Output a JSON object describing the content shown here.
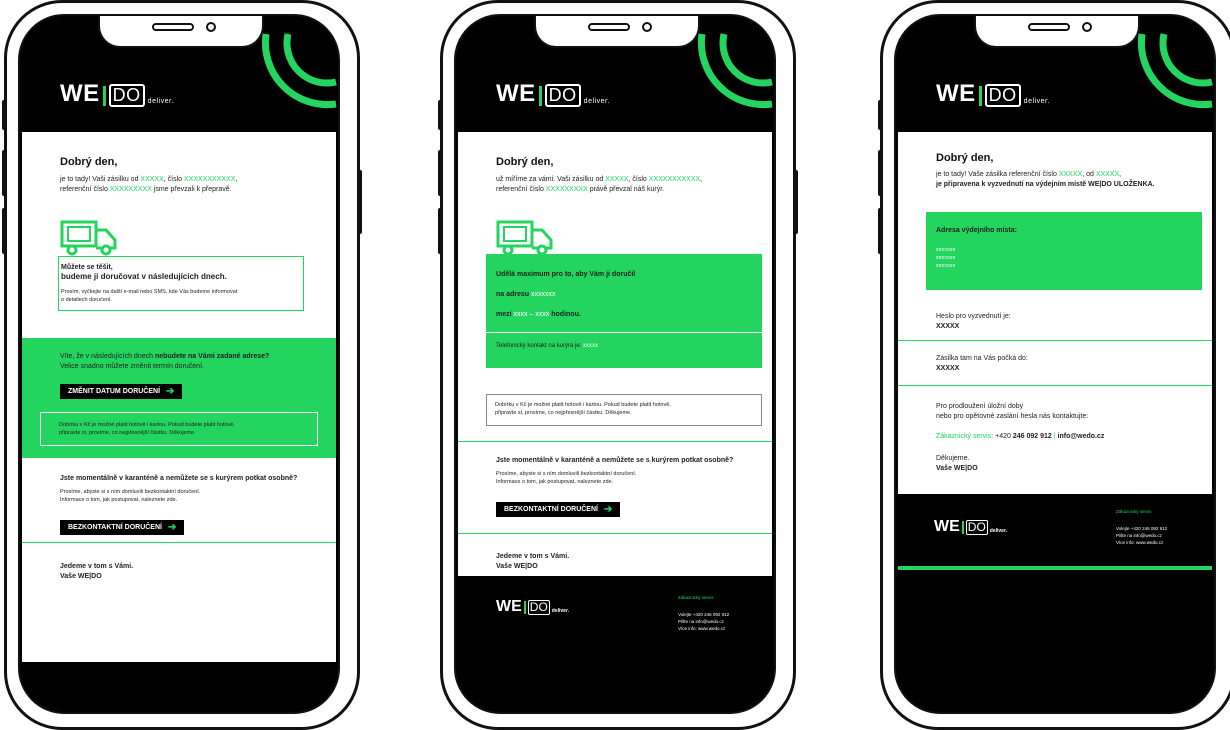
{
  "brand": {
    "we": "WE",
    "do": "DO",
    "deliver": "deliver.",
    "accent": "#23d45e"
  },
  "phone1": {
    "greeting": "Dobrý den,",
    "intro": {
      "p1": "je to tady! Vaši zásilku od ",
      "x1": "XXXXX",
      "p2": ", číslo ",
      "x2": "XXXXXXXXXXX",
      "p3": ",",
      "p4": "referenční číslo ",
      "x3": "XXXXXXXXX",
      "p5": " jsme převzali k přepravě."
    },
    "box1": {
      "g": "Můžete se těšit,",
      "b": "budeme ji doručovat v následujících dnech.",
      "s1": "Prosím, vyčkejte na další e-mail nebo SMS, kde Vás budeme informovat",
      "s2": "o detailech doručení."
    },
    "green": {
      "p1": "Víte, že v následujících dnech ",
      "b1": "nebudete na Vámi zadané adrese?",
      "p2": "Velice snadno můžete změnit termín doručení.",
      "btn": "ZMĚNIT DATUM DORUČENÍ",
      "cod1": "Dobírku v Kč je možné platit hotově i kartou. Pokud budete platit hotově,",
      "cod2": "připravte si, prosíme, co nejpřesnější částku. Děkujeme."
    },
    "quar": {
      "title": "Jste momentálně v karanténě a nemůžete se s kurýrem potkat osobně?",
      "s1": "Prosíme, abyste si s ním domluvili bezkontaktní doručení.",
      "s2": "Informace o tom, jak postupovat, naleznete zde.",
      "btn": "BEZKONTAKTNÍ DORUČENÍ"
    },
    "sign": {
      "l1": "Jedeme v tom s Vámi.",
      "l2": "Vaše WE|DO"
    }
  },
  "phone2": {
    "greeting": "Dobrý den,",
    "intro": {
      "p1": "už míříme za vámi. Vaši zásilku od ",
      "x1": "XXXXX",
      "p2": ", číslo ",
      "x2": "XXXXXXXXXXX",
      "p3": ",",
      "p4": "referenční číslo ",
      "x3": "XXXXXXXXX",
      "p5": " právě převzal náš kurýr."
    },
    "green": {
      "l1": "Udělá maximum pro to, aby Vám ji doručil",
      "l2a": "na adresu ",
      "l2b": "xxxxxxx",
      "l3a": "mezi ",
      "l3b": "xxxx – xxxx",
      "l3c": " hodinou.",
      "tel": "Telefonický kontakt na kurýra je: ",
      "telx": "xxxxx"
    },
    "cod": {
      "s1": "Dobírku v Kč je možné platit hotově i kartou. Pokud budete platit hotově,",
      "s2": "připravte si, prosíme, co nejpřesnější částku. Děkujeme."
    },
    "quar": {
      "title": "Jste momentálně v karanténě a nemůžete se s kurýrem potkat osobně?",
      "s1": "Prosíme, abyste si s ním domluvili bezkontaktní doručení.",
      "s2": "Informace o tom, jak postupovat, naleznete zde.",
      "btn": "BEZKONTAKTNÍ DORUČENÍ"
    },
    "sign": {
      "l1": "Jedeme v tom s Vámi.",
      "l2": "Vaše WE|DO"
    },
    "footer": {
      "t": "Zákaznický servis",
      "l1": "Volejte +420 246 092 912",
      "l2": "Pište na info@wedo.cz",
      "l3": "Více info: www.wedo.cz"
    }
  },
  "phone3": {
    "greeting": "Dobrý den,",
    "intro": {
      "p1": "je to tady! Vaše zásilka referenční číslo ",
      "x1": "XXXXX",
      "p2": ", od ",
      "x2": "XXXXX",
      "p3": ",",
      "b": "je připravena k vyzvednutí na výdejním místě  WE|DO ULOŽENKA."
    },
    "green": {
      "title": "Adresa výdejního místa:",
      "a1": "xxxxxxx",
      "a2": "xxxxxxx",
      "a3": "xxxxxxx"
    },
    "pw": {
      "l": "Heslo pro vyzvednutí je:",
      "v": "XXXXX"
    },
    "wait": {
      "l": "Zásilka tam na Vás počká do:",
      "v": "XXXXX"
    },
    "ext": {
      "l1": "Pro prodloužení úložní doby",
      "l2": "nebo pro opětovné zaslání hesla nás kontaktujte:",
      "cs": "Zákaznický servis:",
      "ph1": " +420 ",
      "ph2": "246 092 912",
      "sep": " | ",
      "mail": "info@wedo.cz"
    },
    "sign": {
      "l1": "Děkujeme.",
      "l2": "Vaše WE|DO"
    },
    "footer": {
      "t": "Zákaznický servis",
      "l1": "Volejte +420 246 092 912",
      "l2": "Pište na info@wedo.cz",
      "l3": "Více info: www.wedo.cz"
    }
  }
}
